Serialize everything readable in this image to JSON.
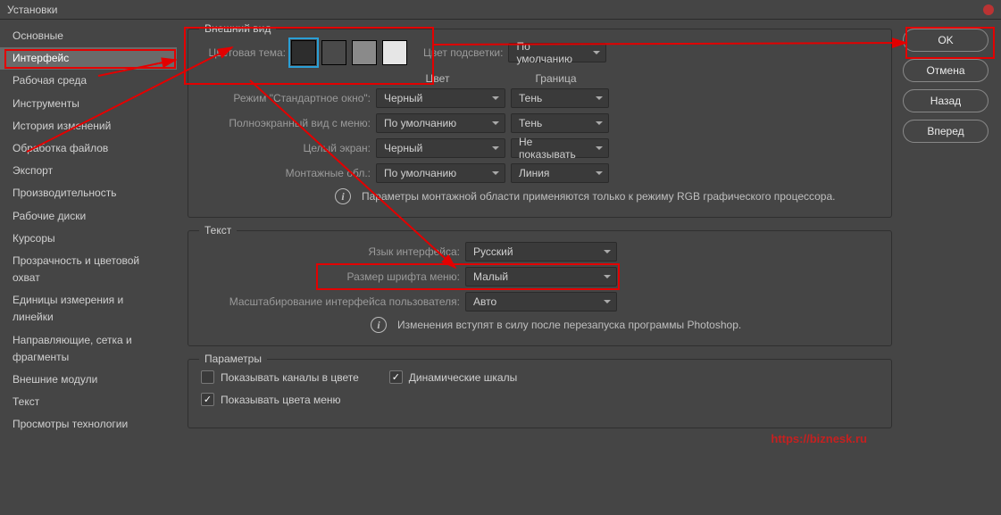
{
  "window": {
    "title": "Установки"
  },
  "sidebar": {
    "items": [
      "Основные",
      "Интерфейс",
      "Рабочая среда",
      "Инструменты",
      "История изменений",
      "Обработка файлов",
      "Экспорт",
      "Производительность",
      "Рабочие диски",
      "Курсоры",
      "Прозрачность и цветовой охват",
      "Единицы измерения и линейки",
      "Направляющие, сетка и фрагменты",
      "Внешние модули",
      "Текст",
      "Просмотры технологии"
    ],
    "selected_index": 1
  },
  "appearance": {
    "legend": "Внешний вид",
    "color_theme_label": "Цветовая тема:",
    "swatches": [
      "#2d2d2d",
      "#4a4a4a",
      "#8a8a8a",
      "#e6e6e6"
    ],
    "selected_swatch": 0,
    "highlight_label": "Цвет подсветки:",
    "highlight_value": "По умолчанию",
    "col_color": "Цвет",
    "col_border": "Граница",
    "rows": [
      {
        "label": "Режим \"Стандартное окно\":",
        "color": "Черный",
        "border": "Тень"
      },
      {
        "label": "Полноэкранный вид с меню:",
        "color": "По умолчанию",
        "border": "Тень"
      },
      {
        "label": "Целый экран:",
        "color": "Черный",
        "border": "Не показывать"
      },
      {
        "label": "Монтажные обл.:",
        "color": "По умолчанию",
        "border": "Линия"
      }
    ],
    "info": "Параметры монтажной области применяются только к режиму RGB графического процессора."
  },
  "text": {
    "legend": "Текст",
    "lang_label": "Язык интерфейса:",
    "lang_value": "Русский",
    "font_label": "Размер шрифта меню:",
    "font_value": "Малый",
    "scale_label": "Масштабирование интерфейса пользователя:",
    "scale_value": "Авто",
    "info": "Изменения вступят в силу после перезапуска программы Photoshop."
  },
  "options": {
    "legend": "Параметры",
    "channels_label": "Показывать каналы в цвете",
    "channels_checked": false,
    "dynamic_label": "Динамические шкалы",
    "dynamic_checked": true,
    "menu_colors_label": "Показывать цвета меню",
    "menu_colors_checked": true
  },
  "buttons": {
    "ok": "OK",
    "cancel": "Отмена",
    "back": "Назад",
    "forward": "Вперед"
  },
  "watermark": "https://biznesk.ru"
}
